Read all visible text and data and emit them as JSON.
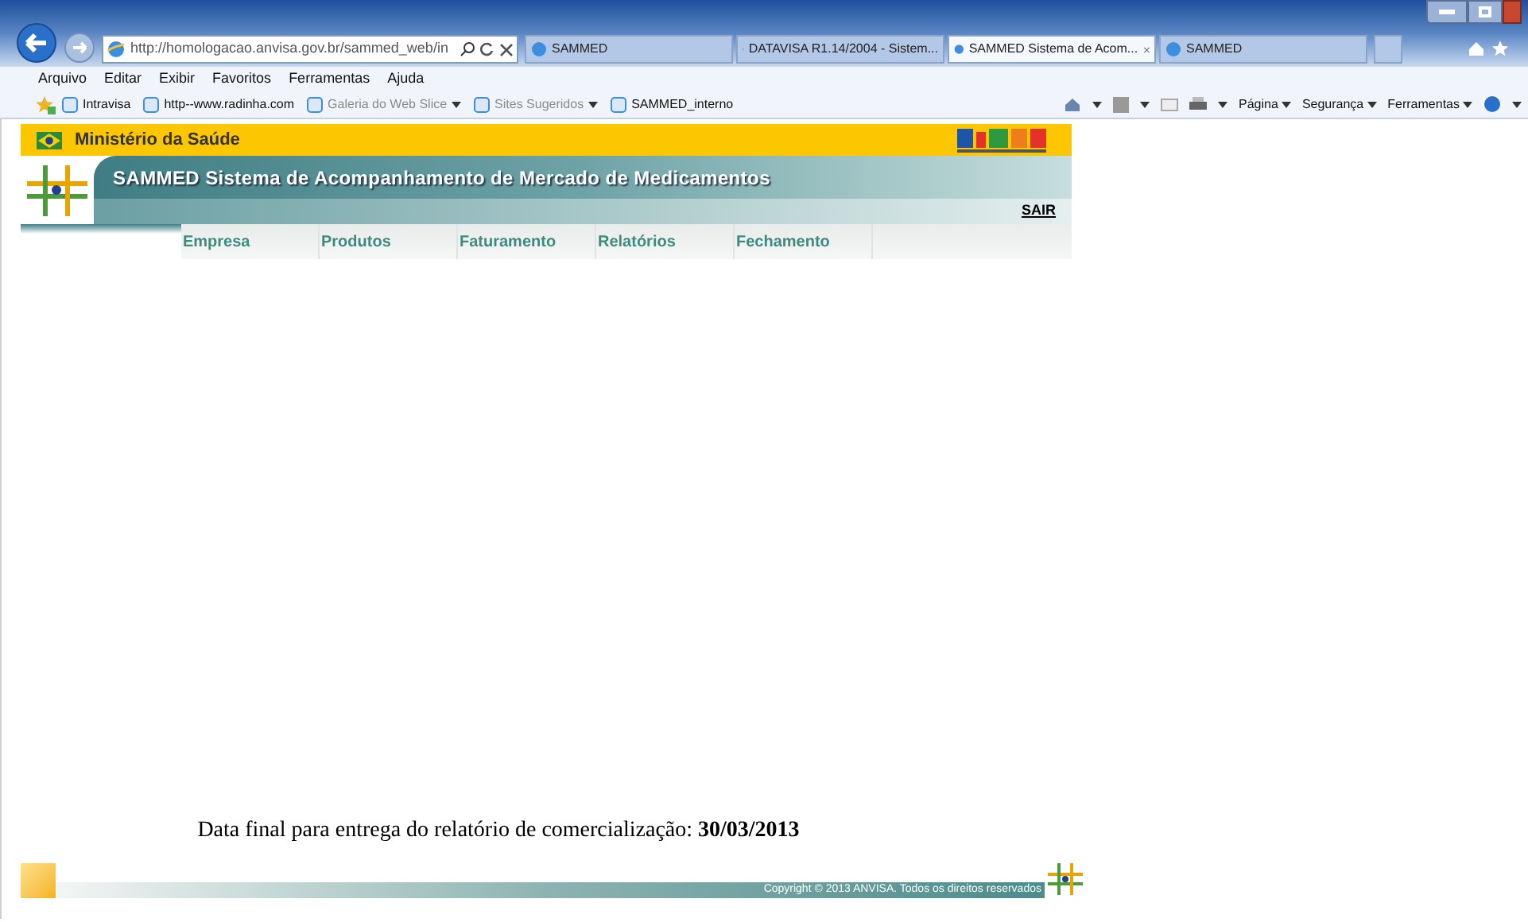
{
  "browser": {
    "address": "http://homologacao.anvisa.gov.br/sammed_web/in",
    "tabs": [
      {
        "label": "SAMMED",
        "selected": false
      },
      {
        "label": "DATAVISA R1.14/2004 - Sistem...",
        "selected": false
      },
      {
        "label": "SAMMED Sistema de Acom...",
        "selected": true
      },
      {
        "label": "SAMMED",
        "selected": false
      }
    ],
    "menu": [
      "Arquivo",
      "Editar",
      "Exibir",
      "Favoritos",
      "Ferramentas",
      "Ajuda"
    ],
    "favorites": [
      {
        "label": "Intravisa",
        "dropdown": false,
        "disabled": false
      },
      {
        "label": "http--www.radinha.com",
        "dropdown": false,
        "disabled": false
      },
      {
        "label": "Galeria do Web Slice",
        "dropdown": true,
        "disabled": true
      },
      {
        "label": "Sites Sugeridos",
        "dropdown": true,
        "disabled": true
      },
      {
        "label": "SAMMED_interno",
        "dropdown": false,
        "disabled": false
      }
    ],
    "command_bar": [
      "Página",
      "Segurança",
      "Ferramentas"
    ]
  },
  "page": {
    "ministry": "Ministério da Saúde",
    "system_title": "SAMMED Sistema de Acompanhamento de Mercado de Medicamentos",
    "logout": "SAIR",
    "nav": [
      "Empresa",
      "Produtos",
      "Faturamento",
      "Relatórios",
      "Fechamento"
    ],
    "deadline": "Data final para entrega do relatório de comercialização: **30/03/2013**",
    "copyright": "Copyright © 2013 ANVISA. Todos os direitos reservados"
  }
}
